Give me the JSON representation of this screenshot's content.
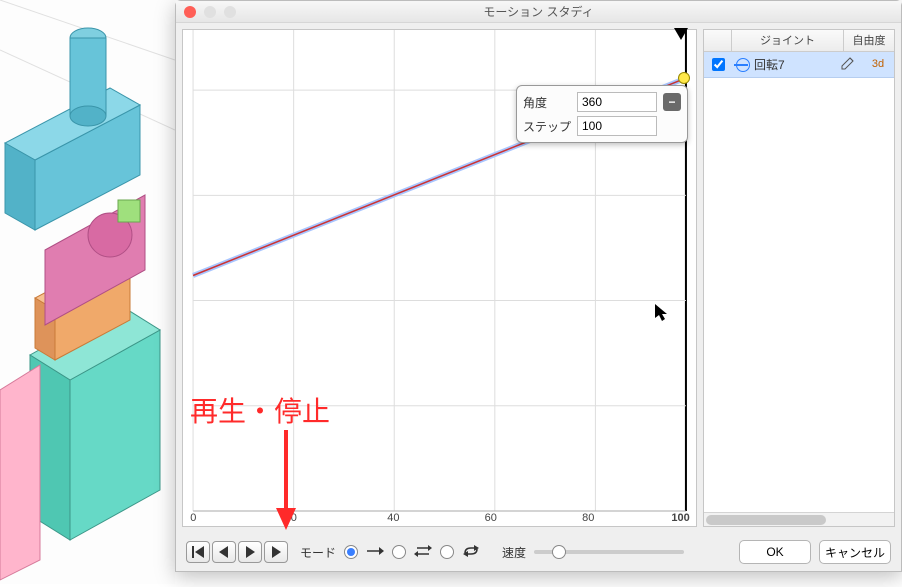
{
  "dialog": {
    "title": "モーション スタディ"
  },
  "graph": {
    "xticks": [
      "0",
      "20",
      "40",
      "60",
      "80",
      "100"
    ],
    "xtick_last_bold": "100",
    "tooltip": {
      "angle_label": "角度",
      "angle_value": "360",
      "steps_label": "ステップ",
      "steps_value": "100"
    }
  },
  "chart_data": {
    "type": "line",
    "title": "",
    "xlabel": "",
    "ylabel": "",
    "x": [
      0,
      100
    ],
    "y": [
      0,
      360
    ],
    "xlim": [
      0,
      100
    ],
    "ylim": [
      0,
      360
    ],
    "series": [
      {
        "name": "回転7",
        "x": [
          0,
          100
        ],
        "y": [
          0,
          360
        ]
      }
    ]
  },
  "side": {
    "headers": {
      "checkbox": "",
      "joint": "ジョイント",
      "dof": "自由度"
    },
    "rows": [
      {
        "checked": true,
        "name": "回転7",
        "dof1": "3",
        "dof2": "d"
      }
    ]
  },
  "controls": {
    "mode_label": "モード",
    "speed_label": "速度"
  },
  "buttons": {
    "ok": "OK",
    "cancel": "キャンセル"
  },
  "annotation": {
    "text": "再生・停止"
  }
}
